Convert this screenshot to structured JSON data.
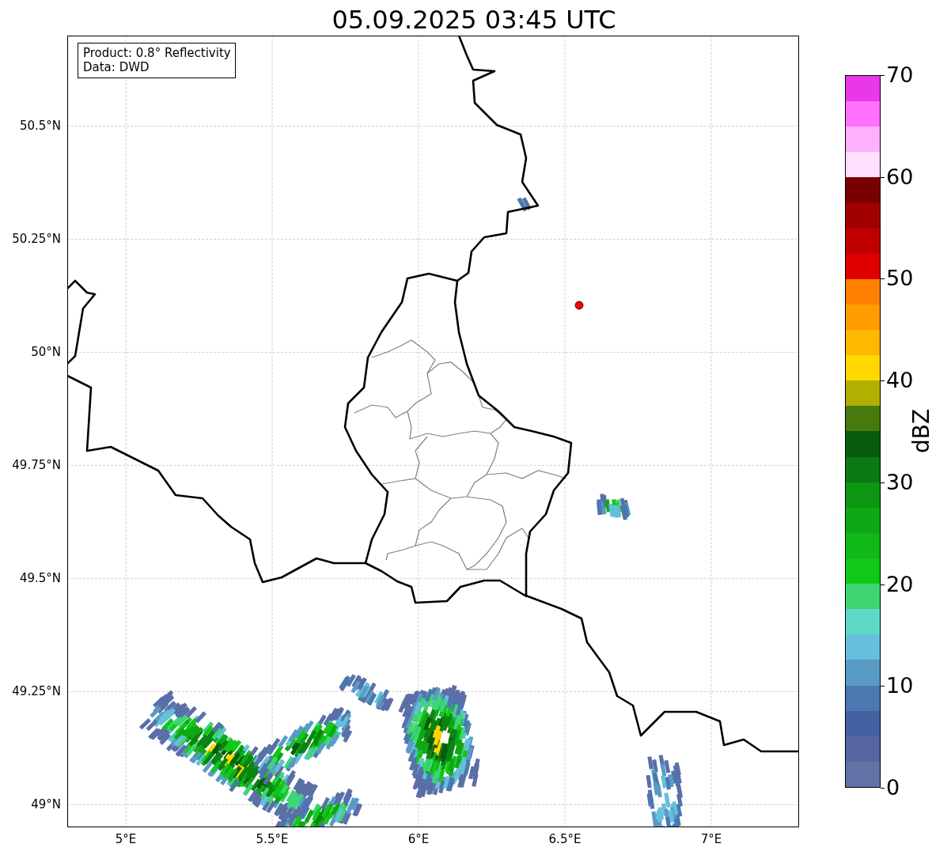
{
  "title": "05.09.2025 03:45 UTC",
  "map": {
    "info_box": [
      "Product: 0.8° Reflectivity",
      "Data: DWD"
    ],
    "xticks": [
      "5°E",
      "5.5°E",
      "6°E",
      "6.5°E",
      "7°E"
    ],
    "yticks": [
      "50.5°N",
      "50.25°N",
      "50°N",
      "49.75°N",
      "49.5°N",
      "49.25°N",
      "49°N"
    ]
  },
  "colorbar": {
    "label": "dBZ",
    "ticks": [
      "70",
      "60",
      "50",
      "40",
      "30",
      "20",
      "10",
      "0"
    ],
    "segments": [
      {
        "color": "#6372a6"
      },
      {
        "color": "#5566a0"
      },
      {
        "color": "#4360a0"
      },
      {
        "color": "#4a78b0"
      },
      {
        "color": "#5a9bc6"
      },
      {
        "color": "#64c0dc"
      },
      {
        "color": "#60d8c8"
      },
      {
        "color": "#3dd672"
      },
      {
        "color": "#10c818"
      },
      {
        "color": "#10b818"
      },
      {
        "color": "#0ea814"
      },
      {
        "color": "#0c9612"
      },
      {
        "color": "#0a7a12"
      },
      {
        "color": "#065c0c"
      },
      {
        "color": "#467a0c"
      },
      {
        "color": "#b0b000"
      },
      {
        "color": "#ffd800"
      },
      {
        "color": "#ffb800"
      },
      {
        "color": "#ff9c00"
      },
      {
        "color": "#ff8000"
      },
      {
        "color": "#e00000"
      },
      {
        "color": "#c00000"
      },
      {
        "color": "#a00000"
      },
      {
        "color": "#780000"
      },
      {
        "color": "#ffe0ff"
      },
      {
        "color": "#ffb0ff"
      },
      {
        "color": "#ff70ff"
      },
      {
        "color": "#e838e8"
      }
    ]
  }
}
